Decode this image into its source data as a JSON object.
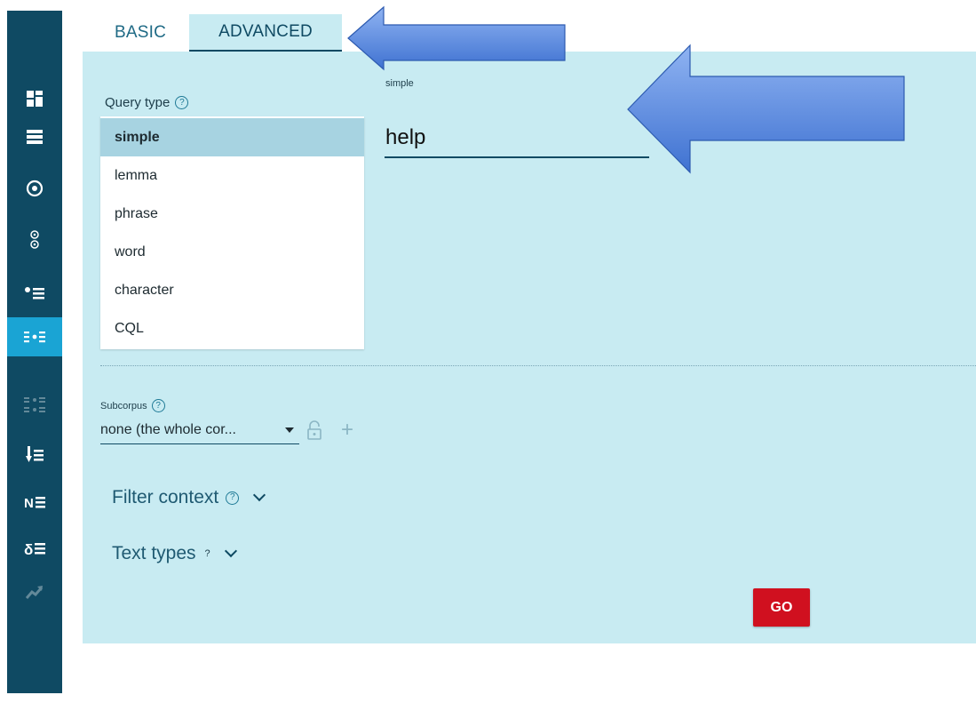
{
  "tabs": {
    "basic": "BASIC",
    "advanced": "ADVANCED"
  },
  "sidebar": {
    "items": [
      {
        "icon": "dashboard-icon"
      },
      {
        "icon": "list-icon"
      },
      {
        "icon": "target-icon"
      },
      {
        "icon": "double-target-icon"
      },
      {
        "icon": "bullet-list-icon"
      },
      {
        "icon": "concordance-icon",
        "active": true
      },
      {
        "icon": "parallel-concordance-icon",
        "disabled": true
      },
      {
        "icon": "sorted-list-icon"
      },
      {
        "icon": "ngram-icon"
      },
      {
        "icon": "keywords-icon"
      },
      {
        "icon": "trends-icon",
        "disabled": true
      }
    ]
  },
  "query_type": {
    "label": "Query type",
    "help": "?",
    "options": [
      "simple",
      "lemma",
      "phrase",
      "word",
      "character",
      "CQL"
    ],
    "selected": "simple"
  },
  "query_input": {
    "label": "simple",
    "value": "help"
  },
  "subcorpus": {
    "label": "Subcorpus",
    "help": "?",
    "value": "none (the whole cor...",
    "add": "+"
  },
  "filter_context": {
    "label": "Filter context",
    "help": "?"
  },
  "text_types": {
    "label": "Text types",
    "help": "?"
  },
  "go_button": "GO",
  "colors": {
    "sidebar": "#0f4a63",
    "active": "#1aa4d4",
    "panel": "#c8ebf2",
    "go": "#d0101f"
  }
}
